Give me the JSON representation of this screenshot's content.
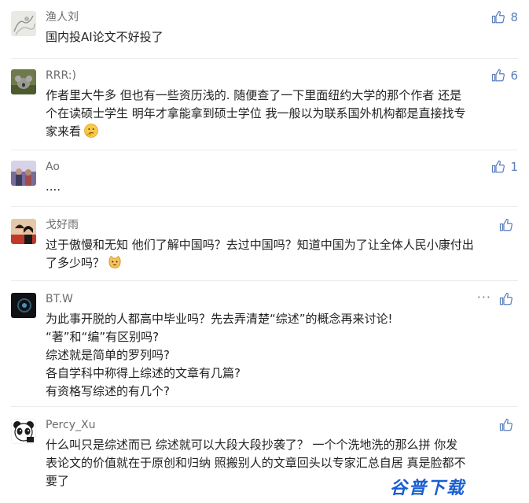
{
  "comments": [
    {
      "username": "渔人刘",
      "lines": [
        "国内投AI论文不好投了"
      ],
      "likes": "8",
      "avatar_icon": "sketch-avatar"
    },
    {
      "username": "RRR:)",
      "lines": [
        "作者里大牛多  但也有一些资历浅的.  随便查了一下里面纽约大学的那个作者  还是",
        "个在读硕士学生  明年才拿能拿到硕士学位   我一般以为联系国外机构都是直接找专",
        "家来看"
      ],
      "emoji": "thinking-face-emoji",
      "likes": "6",
      "avatar_icon": "koala-avatar"
    },
    {
      "username": "Ao",
      "lines": [
        "...."
      ],
      "likes": "1",
      "avatar_icon": "photo-avatar"
    },
    {
      "username": "戈好雨",
      "lines": [
        "过于傲慢和无知  他们了解中国吗？去过中国吗？知道中国为了让全体人民小康付出",
        "了多少吗？"
      ],
      "emoji": "cat-face-emoji",
      "likes": "",
      "avatar_icon": "couple-photo-avatar"
    },
    {
      "username": "BT.W",
      "lines": [
        "为此事开脱的人都高中毕业吗？先去弄清楚“综述”的概念再来讨论!",
        "“著”和“编”有区别吗?",
        "综述就是简单的罗列吗?",
        "各自学科中称得上综述的文章有几篇?",
        "有资格写综述的有几个?"
      ],
      "more": "···",
      "likes": "",
      "avatar_icon": "dark-circle-avatar"
    },
    {
      "username": "Percy_Xu",
      "lines": [
        "什么叫只是综述而已   综述就可以大段大段抄袭了？    一个个洗地洗的那么拼    你发",
        "表论文的价值就在于原创和归纳   照搬别人的文章回头以专家汇总自居    真是脸都不",
        "要了"
      ],
      "likes": "",
      "avatar_icon": "panda-avatar"
    }
  ],
  "watermark": "谷普下载",
  "colors": {
    "like": "#5a7dbb",
    "username": "#6b6b6b",
    "text": "#222222",
    "watermark": "#1a5fd1"
  }
}
